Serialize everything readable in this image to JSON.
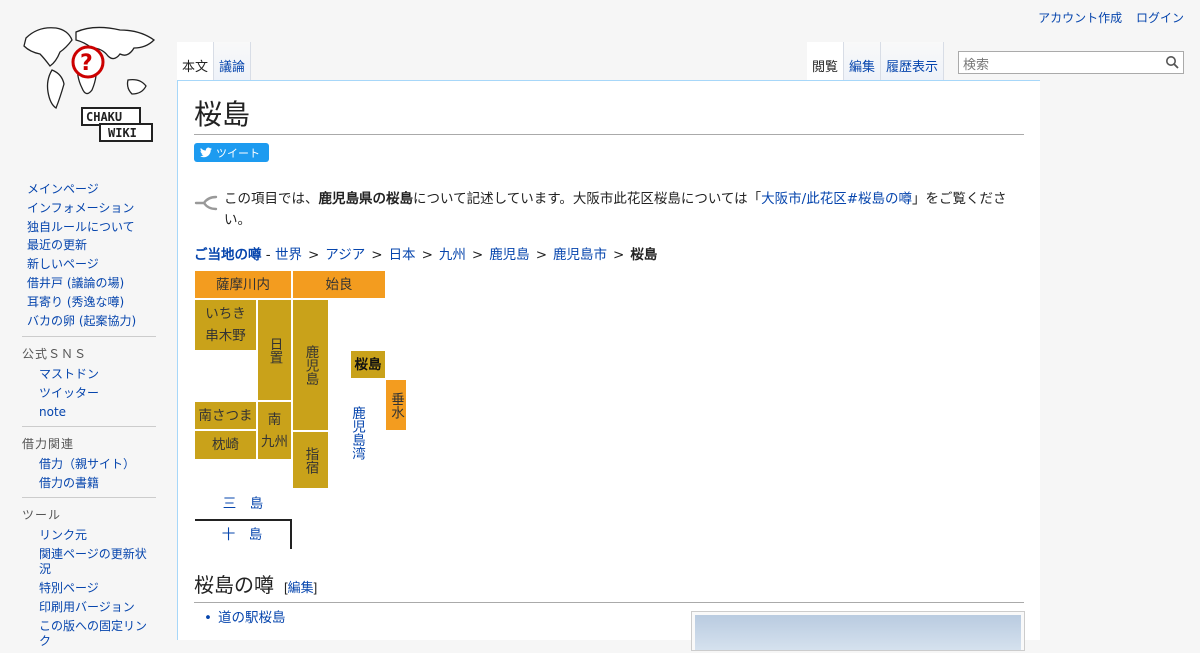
{
  "personal": {
    "create_account": "アカウント作成",
    "login": "ログイン"
  },
  "logo": {
    "line1": "CHAKU",
    "line2": "WIKI"
  },
  "tabs": {
    "left": [
      {
        "label": "本文",
        "selected": true
      },
      {
        "label": "議論",
        "selected": false
      }
    ],
    "right": [
      {
        "label": "閲覧",
        "selected": true
      },
      {
        "label": "編集",
        "selected": false
      },
      {
        "label": "履歴表示",
        "selected": false
      }
    ]
  },
  "search": {
    "placeholder": "検索"
  },
  "sidebar": {
    "nav": [
      "メインページ",
      "インフォメーション",
      "独自ルールについて",
      "最近の更新",
      "新しいページ",
      "借井戸 (議論の場)",
      "耳寄り (秀逸な噂)",
      "バカの卵 (起案協力)"
    ],
    "sns": {
      "heading": "公式ＳＮＳ",
      "items": [
        "マストドン",
        "ツイッター",
        "note"
      ]
    },
    "related": {
      "heading": "借力関連",
      "items": [
        "借力（親サイト）",
        "借力の書籍"
      ]
    },
    "tools": {
      "heading": "ツール",
      "items": [
        "リンク元",
        "関連ページの更新状況",
        "特別ページ",
        "印刷用バージョン",
        "この版への固定リンク"
      ]
    }
  },
  "page": {
    "title": "桜島",
    "tweet": "ツイート",
    "hatnote": {
      "pre": "この項目では、",
      "bold": "鹿児島県の桜島",
      "mid": "について記述しています。大阪市此花区桜島については「",
      "link": "大阪市/此花区#桜島の噂",
      "post": "」をご覧ください。"
    },
    "breadcrumb": {
      "lead": "ご当地の噂",
      "dash": " - ",
      "items": [
        "世界",
        "アジア",
        "日本",
        "九州",
        "鹿児島",
        "鹿児島市"
      ],
      "current": "桜島",
      "sep": ">"
    },
    "map": {
      "satsumasendai": "薩摩川内",
      "aira": "始良",
      "ichiki1": "いちき",
      "ichiki2": "串木野",
      "hioki": "日置",
      "kagoshima": "鹿児島",
      "sakurajima": "桜島",
      "tarumizu": "垂水",
      "kagoshimawan": "鹿児島湾",
      "minamisatsuma": "南さつま",
      "minamikyushu1": "南",
      "minamikyushu2": "九州",
      "makurazaki": "枕崎",
      "ibusuki": "指宿",
      "mishima": "三　島",
      "toshima": "十　島"
    },
    "section": {
      "title": "桜島の噂",
      "edit": "編集",
      "bracket_open": "[",
      "bracket_close": "]"
    },
    "bullet": "道の駅桜島"
  },
  "colors": {
    "gold": "#c9a21a",
    "orange": "#f39c1f",
    "link": "#0645ad",
    "tweet": "#1d9bf0"
  }
}
